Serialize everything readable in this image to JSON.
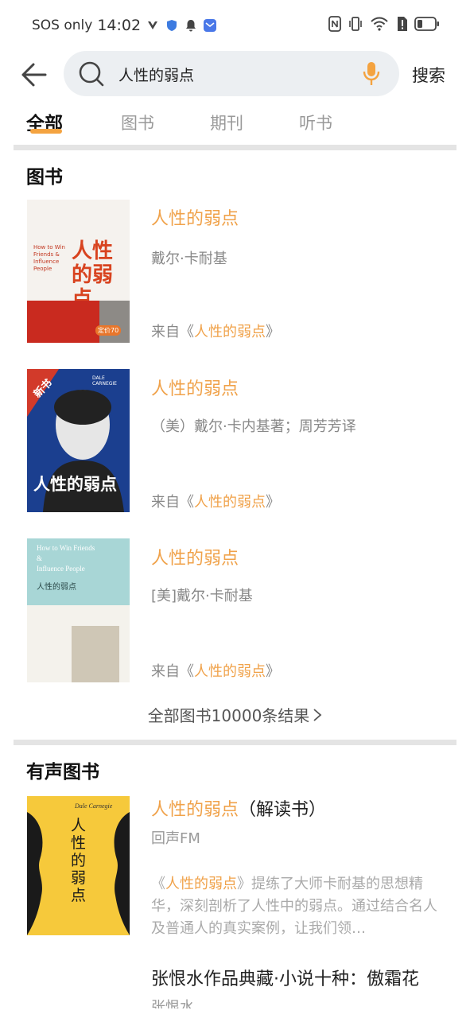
{
  "status_bar": {
    "carrier": "SOS only",
    "time": "14:02"
  },
  "search": {
    "query": "人性的弱点",
    "button_label": "搜索"
  },
  "tabs": [
    {
      "label": "全部"
    },
    {
      "label": "图书"
    },
    {
      "label": "期刊"
    },
    {
      "label": "听书"
    }
  ],
  "books_section": {
    "title": "图书",
    "items": [
      {
        "title": "人性的弱点",
        "author": "戴尔·卡耐基",
        "source_prefix": "来自《",
        "source_name": "人性的弱点",
        "source_suffix": "》",
        "cover": {
          "en_title": "How to Win Friends & Influence People",
          "cn_title": "人性的弱点",
          "price_tag": "定价70"
        }
      },
      {
        "title": "人性的弱点",
        "author": "（美）戴尔·卡内基著；周芳芳译",
        "source_prefix": "来自《",
        "source_name": "人性的弱点",
        "source_suffix": "》",
        "cover": {
          "badge": "新书",
          "author_line": "DALE CARNEGIE",
          "cn_title": "人性的弱点"
        }
      },
      {
        "title": "人性的弱点",
        "author": "[美]戴尔·卡耐基",
        "source_prefix": "来自《",
        "source_name": "人性的弱点",
        "source_suffix": "》",
        "cover": {
          "en_title_1": "How to Win Friends",
          "en_title_2": "&",
          "en_title_3": "Influence People",
          "cn_title": "人性的弱点"
        }
      }
    ],
    "all_results_label": "全部图书10000条结果"
  },
  "audio_section": {
    "title": "有声图书",
    "items": [
      {
        "title_hl": "人性的弱点",
        "title_rest": "（解读书）",
        "publisher": "回声FM",
        "desc_prefix": "《",
        "desc_hl": "人性的弱点",
        "desc_rest": "》提练了大师卡耐基的思想精华，深刻剖析了人性中的弱点。通过结合名人及普通人的真实案例，让我们领…",
        "cover": {
          "cn_title": "人性的弱点",
          "signature": "Dale Carnegie"
        }
      },
      {
        "title": "张恨水作品典藏·小说十种：傲霜花",
        "author": "张恨水"
      }
    ]
  },
  "colors": {
    "accent": "#f0a24a",
    "tab_underline": "#f4a340",
    "search_bg": "#eceff2",
    "divider": "#e4e4e4"
  }
}
